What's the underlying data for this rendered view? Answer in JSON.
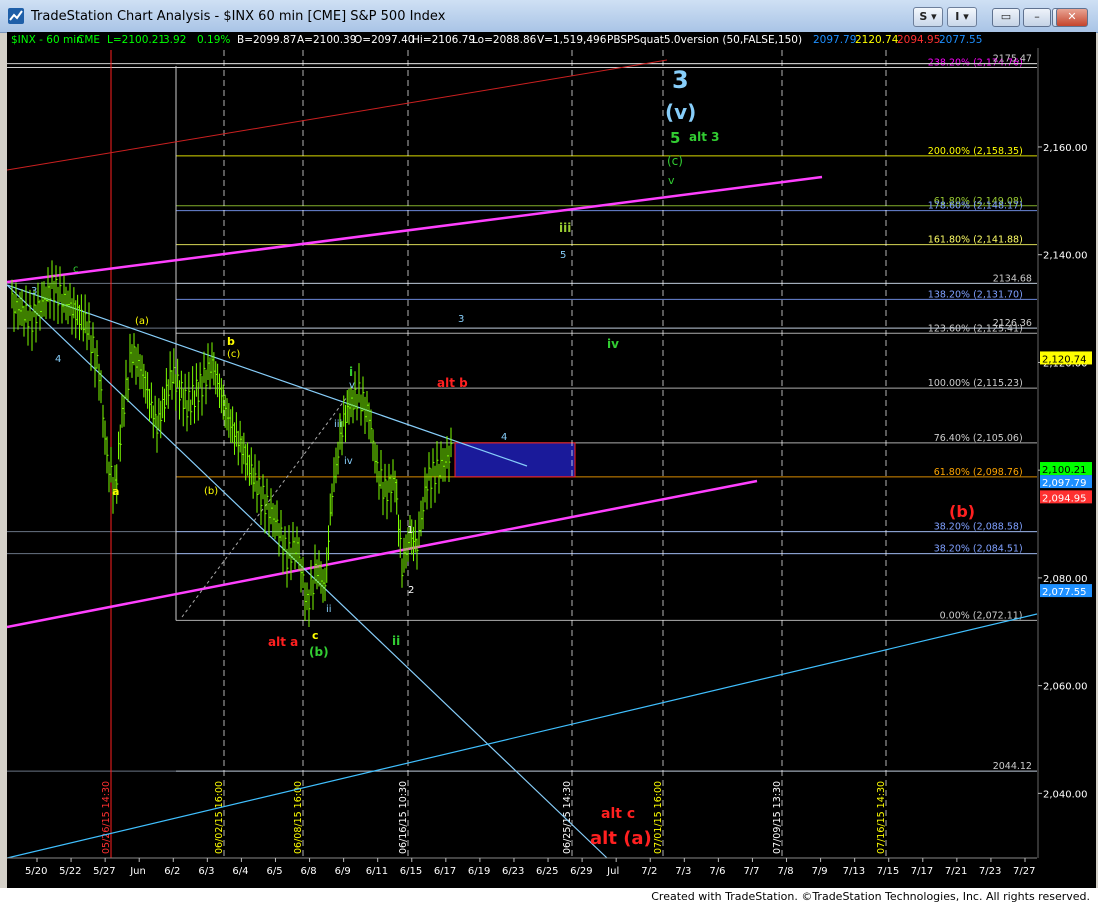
{
  "window": {
    "title": "TradeStation Chart Analysis - $INX 60 min [CME] S&P 500 Index",
    "btn_s": "S",
    "btn_i": "I"
  },
  "header": {
    "symbol": "$INX - 60 min",
    "exchange": "CME",
    "last": "L=2100.21",
    "change": "3.92",
    "pct": "0.19%",
    "bid": "B=2099.87",
    "ask": "A=2100.39",
    "open": "O=2097.40",
    "hi": "Hi=2106.79",
    "lo": "Lo=2088.86",
    "vol": "V=1,519,496",
    "indicator": "PBSPSquat5.0version (50,FALSE,150)",
    "ind_v1": "2097.79",
    "ind_v2": "2120.74",
    "ind_v3": "2094.95",
    "ind_v4": "2077.55"
  },
  "chart_data": {
    "type": "candlestick",
    "symbol": "$INX",
    "interval": "60 min",
    "ylim": [
      2028,
      2178
    ],
    "y_ticks": [
      "2,160.00",
      "2,140.00",
      "2,120.00",
      "2,100.00",
      "2,080.00",
      "2,060.00",
      "2,040.00"
    ],
    "x_ticks": [
      "5/20",
      "5/22",
      "5/27",
      "Jun",
      "6/2",
      "6/3",
      "6/4",
      "6/5",
      "6/8",
      "6/9",
      "6/11",
      "6/15",
      "6/17",
      "6/19",
      "6/23",
      "6/25",
      "6/29",
      "Jul",
      "7/2",
      "7/3",
      "7/6",
      "7/7",
      "7/8",
      "7/9",
      "7/13",
      "7/15",
      "7/17",
      "7/21",
      "7/23",
      "7/27"
    ],
    "price_labels": [
      {
        "text": "2,120.74",
        "color": "#ffff00"
      },
      {
        "text": "2,100.21",
        "color": "#00ff00"
      },
      {
        "text": "2,097.79",
        "color": "#1e90ff"
      },
      {
        "text": "2,094.95",
        "color": "#ff3030"
      },
      {
        "text": "2,077.55",
        "color": "#1e90ff"
      }
    ],
    "level_lines": [
      {
        "label": "238.20% (2,174.76)",
        "color": "#ff00ff",
        "level": 2174.76
      },
      {
        "label": "2175.47",
        "color": "#cccccc",
        "level": 2175.47
      },
      {
        "label": "200.00% (2,158.35)",
        "color": "#ffff00",
        "level": 2158.35
      },
      {
        "label": "61.80% (2,149.08)",
        "color": "#9acd32",
        "level": 2149.08
      },
      {
        "label": "178.60% (2,148.17)",
        "color": "#7fa0ff",
        "level": 2148.17
      },
      {
        "label": "161.80% (2,141.88)",
        "color": "#ffff66",
        "level": 2141.88
      },
      {
        "label": "2134.68",
        "color": "#cccccc",
        "level": 2134.68
      },
      {
        "label": "138.20% (2,131.70)",
        "color": "#7fa0ff",
        "level": 2131.7
      },
      {
        "label": "2126.36",
        "color": "#cccccc",
        "level": 2126.36
      },
      {
        "label": "123.60% (2,125.41)",
        "color": "#cccccc",
        "level": 2125.41
      },
      {
        "label": "100.00% (2,115.23)",
        "color": "#cccccc",
        "level": 2115.23
      },
      {
        "label": "76.40% (2,105.06)",
        "color": "#cccccc",
        "level": 2105.06
      },
      {
        "label": "61.80% (2,098.76)",
        "color": "#ffa500",
        "level": 2098.76
      },
      {
        "label": "38.20% (2,088.58)",
        "color": "#7fa0ff",
        "level": 2088.58
      },
      {
        "label": "38.20% (2,084.51)",
        "color": "#7fa0ff",
        "level": 2084.51
      },
      {
        "label": "0.00% (2,072.11)",
        "color": "#cccccc",
        "level": 2072.11
      },
      {
        "label": "2044.12",
        "color": "#cccccc",
        "level": 2044.12
      }
    ],
    "vertical_time_labels": [
      {
        "text": "05/26/15 14:30",
        "color": "#ff3030"
      },
      {
        "text": "06/02/15 16:00",
        "color": "#ffff00"
      },
      {
        "text": "06/08/15 16:00",
        "color": "#ffff00"
      },
      {
        "text": "06/16/15 10:30",
        "color": "#ffffff"
      },
      {
        "text": "06/25/15 14:30",
        "color": "#ffffff"
      },
      {
        "text": "07/01/15 16:00",
        "color": "#ffff00"
      },
      {
        "text": "07/09/15 13:30",
        "color": "#ffffff"
      },
      {
        "text": "07/16/15 14:30",
        "color": "#ffff00"
      }
    ],
    "wave_labels": [
      {
        "text": "3",
        "color": "#87cefa"
      },
      {
        "text": "(v)",
        "color": "#87cefa"
      },
      {
        "text": "5",
        "color": "#32cd32"
      },
      {
        "text": "alt 3",
        "color": "#32cd32"
      },
      {
        "text": "(c)",
        "color": "#32cd32"
      },
      {
        "text": "v",
        "color": "#32cd32"
      },
      {
        "text": "iii",
        "color": "#9acd32"
      },
      {
        "text": "5",
        "color": "#87cefa"
      },
      {
        "text": "3",
        "color": "#87cefa"
      },
      {
        "text": "iv",
        "color": "#32cd32"
      },
      {
        "text": "alt b",
        "color": "#ff2020"
      },
      {
        "text": "4",
        "color": "#87cefa"
      },
      {
        "text": "(b)",
        "color": "#ff2020"
      },
      {
        "text": "c",
        "color": "#32cd32"
      },
      {
        "text": "3",
        "color": "#87cefa"
      },
      {
        "text": "4",
        "color": "#87cefa"
      },
      {
        "text": "(a)",
        "color": "#ffff00"
      },
      {
        "text": "b",
        "color": "#ffff00"
      },
      {
        "text": "(c)",
        "color": "#ffff00"
      },
      {
        "text": "(b)",
        "color": "#ffff00"
      },
      {
        "text": "a",
        "color": "#ffff00"
      },
      {
        "text": "i",
        "color": "#32cd32"
      },
      {
        "text": "v",
        "color": "#87cefa"
      },
      {
        "text": "iii",
        "color": "#87cefa"
      },
      {
        "text": "iv",
        "color": "#87cefa"
      },
      {
        "text": "ii",
        "color": "#87cefa"
      },
      {
        "text": "c",
        "color": "#ffff00"
      },
      {
        "text": "(b)",
        "color": "#32cd32"
      },
      {
        "text": "alt a",
        "color": "#ff2020"
      },
      {
        "text": "1",
        "color": "#ffffff"
      },
      {
        "text": "2",
        "color": "#ffffff"
      },
      {
        "text": "ii",
        "color": "#32cd32"
      },
      {
        "text": "alt c",
        "color": "#ff2020"
      },
      {
        "text": "alt (a)",
        "color": "#ff2020"
      }
    ]
  },
  "footer": {
    "copyright": "Created with TradeStation. ©TradeStation Technologies, Inc. All rights reserved."
  }
}
